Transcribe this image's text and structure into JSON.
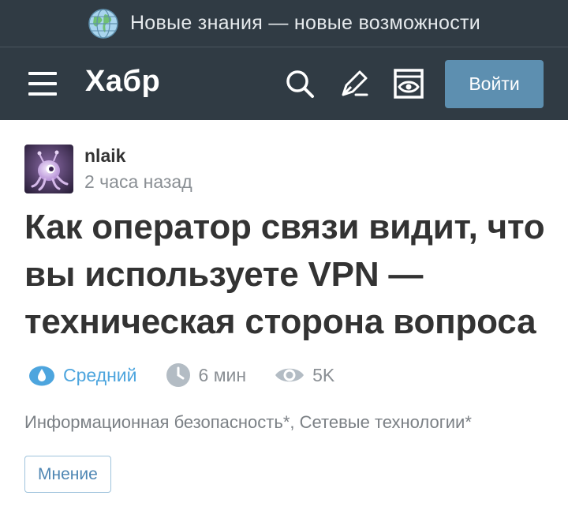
{
  "topbar": {
    "slogan": "Новые знания — новые возможности",
    "icon": "globe-icon"
  },
  "header": {
    "logo": "Хабр",
    "icons": [
      "menu-icon",
      "search-icon",
      "write-icon",
      "reading-mode-icon"
    ],
    "login_label": "Войти"
  },
  "article": {
    "author": {
      "name": "nlaik",
      "time": "2 часа назад"
    },
    "title": "Как оператор связи видит, что вы используете VPN — техническая сторона вопроса",
    "meta": {
      "level": "Средний",
      "read_time": "6 мин",
      "views": "5K"
    },
    "hubs": [
      "Информационная безопасность*",
      "Сетевые технологии*"
    ],
    "badge": "Мнение"
  },
  "colors": {
    "header_bg": "#303b44",
    "accent": "#5d8fb0",
    "level": "#4da5de"
  }
}
